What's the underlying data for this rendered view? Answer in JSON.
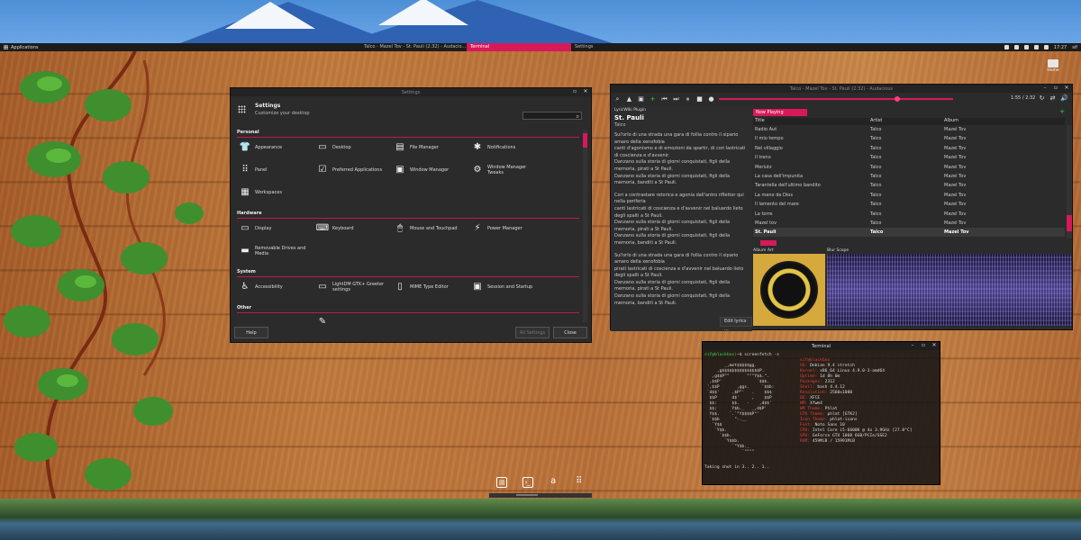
{
  "top_panel": {
    "applications_label": "Applications",
    "tasks": [
      {
        "label": "Talco - Mazel Tov - St. Pauli (2:32) - Audacio..."
      },
      {
        "label": "Terminal"
      },
      {
        "label": "Settings"
      }
    ],
    "time": "17:27",
    "user": "sif"
  },
  "desktop": {
    "icon_label": "Home"
  },
  "settings": {
    "title": "Settings",
    "header_title": "Settings",
    "header_subtitle": "Customize your desktop",
    "categories": {
      "personal": "Personal",
      "hardware": "Hardware",
      "system": "System",
      "other": "Other"
    },
    "personal_items": [
      "Appearance",
      "Desktop",
      "File Manager",
      "Notifications",
      "Panel",
      "Preferred Applications",
      "Window Manager",
      "Window Manager Tweaks",
      "Workspaces"
    ],
    "hardware_items": [
      "Display",
      "Keyboard",
      "Mouse and Touchpad",
      "Power Manager",
      "Removable Drives and Media"
    ],
    "system_items": [
      "Accessibility",
      "LightDM GTK+ Greeter settings",
      "MIME Type Editor",
      "Session and Startup"
    ],
    "help_label": "Help",
    "all_settings_label": "All Settings",
    "close_label": "Close"
  },
  "audacious": {
    "title": "Talco - Mazel Tov - St. Pauli (2:32) - Audacious",
    "time": "1:55 / 2:32",
    "seek_fraction": 0.76,
    "lyrics": {
      "plugin": "LyricWiki Plugin",
      "song": "St. Pauli",
      "artist": "Talco",
      "paragraphs": [
        "Sul'orlo di una strada una gara di follia contro il sipario amaro della xenofobia\ncanti d'agonismo e di emozioni da spartir, di cori lastricati di coscienza e d'avvenir.\nDanzano sulla storia di giorni conquistati, figli della memoria, pirati a St Pauli.\nDanzano sulla storia di giorni conquistati, figli della memoria, banditi a St Pauli.",
        "Cori a contrastare retorica e agonia dall'antro riflettor qui nella periferia\ncanti lastricati di coscienza e d'avvenir nel baluardo lieto degli spalti a St Pauli.\nDanzano sulla storia di giorni conquistati, figli della memoria, pirati a St Pauli.\nDanzano sulla storia di giorni conquistati, figli della memoria, banditi a St Pauli.",
        "Sul'orlo di una strada una gara di follia contro il sipario amaro della xenofobia\npiratí lastricati di coscienza e d'avvenir nel baluardo lieto degli spalti a St Pauli.\nDanzano sulla storia di giorni conquistati, figli della memoria, pirati a St Pauli.\nDanzano sulla storia di giorni conquistati, figli della memoria, banditi a St Pauli."
      ],
      "edit_label": "Edit lyrics ..."
    },
    "playlist": {
      "tab": "Now Playing",
      "columns": [
        "Title",
        "Artist",
        "Album"
      ],
      "rows": [
        [
          "Radio Aut",
          "Talco",
          "Mazel Tov"
        ],
        [
          "Il mio tempo",
          "Talco",
          "Mazel Tov"
        ],
        [
          "Nel villaggio",
          "Talco",
          "Mazel Tov"
        ],
        [
          "Il treno",
          "Talco",
          "Mazel Tov"
        ],
        [
          "Merlutz",
          "Talco",
          "Mazel Tov"
        ],
        [
          "La casa dell'impunita",
          "Talco",
          "Mazel Tov"
        ],
        [
          "Tarantella dell'ultimo bandito",
          "Talco",
          "Mazel Tov"
        ],
        [
          "La mano de Dios",
          "Talco",
          "Mazel Tov"
        ],
        [
          "Il lamento del mare",
          "Talco",
          "Mazel Tov"
        ],
        [
          "La torre",
          "Talco",
          "Mazel Tov"
        ],
        [
          "Mazel tov",
          "Talco",
          "Mazel Tov"
        ],
        [
          "St. Pauli",
          "Talco",
          "Mazel Tov"
        ]
      ],
      "current_index": 11
    },
    "album_art_label": "Album Art",
    "blur_scope_label": "Blur Scope"
  },
  "terminal": {
    "title": "Terminal",
    "prompt_user": "sif@blackbox",
    "prompt_rest": ":~$ screenfetch -s",
    "info_user": "sif@blackbox",
    "info": [
      {
        "k": "OS:",
        "v": " Debian 9.4 stretch"
      },
      {
        "k": "Kernel:",
        "v": " x86_64 Linux 4.9.0-3-amd64"
      },
      {
        "k": "Uptime:",
        "v": " 1d 8h 0m"
      },
      {
        "k": "Packages:",
        "v": " 2312"
      },
      {
        "k": "Shell:",
        "v": " bash 4.4.12"
      },
      {
        "k": "Resolution:",
        "v": " 2560x1080"
      },
      {
        "k": "DE:",
        "v": " XFCE"
      },
      {
        "k": "WM:",
        "v": " Xfwm4"
      },
      {
        "k": "WM Theme:",
        "v": " Phlat"
      },
      {
        "k": "GTK Theme:",
        "v": " phlat [GTK2]"
      },
      {
        "k": "Icon Theme:",
        "v": " phlat-icons"
      },
      {
        "k": "Font:",
        "v": " Noto Sans 10"
      },
      {
        "k": "CPU:",
        "v": " Intel Core i5-6600K @ 4x 3.9GHz [27.8°C]"
      },
      {
        "k": "GPU:",
        "v": " GeForce GTX 1060 6GB/PCIe/SSE2"
      },
      {
        "k": "RAM:",
        "v": " 459MiB / 15991MiB"
      }
    ],
    "ascii": [
      "        _,met$$$$$gg.",
      "     ,g$$$$$$$$$$$$$$$P.",
      "   ,g$$P\"\"       \"\"\"Y$$.\".",
      "  ,$$P'              `$$$.",
      " ',$$P       ,ggs.     `$$b:",
      " `d$$'     ,$P\"'   .    $$$",
      "  $$P      d$'     ,    $$P",
      "  $$:      $$.   -    ,d$$'",
      "  $$;      Y$b._   _,d$P'",
      "  Y$$.    `.`\"Y$$$$P\"'",
      "  `$$b      \"-.__",
      "   `Y$$",
      "    `Y$$.",
      "      `$$b.",
      "        `Y$$b.",
      "           `\"Y$b._",
      "               `\"\"\"\""
    ],
    "shot_line": "Taking shot in 3.. 2.. 1.."
  }
}
